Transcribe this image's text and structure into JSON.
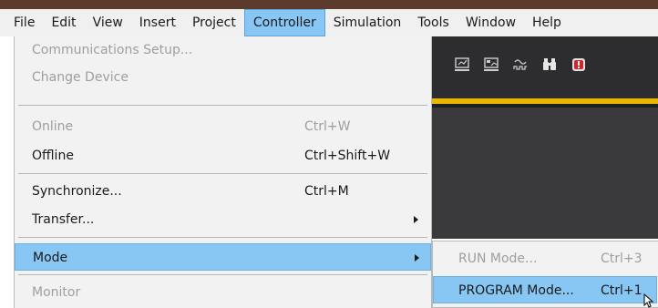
{
  "menubar": {
    "items": [
      {
        "label": "File"
      },
      {
        "label": "Edit"
      },
      {
        "label": "View"
      },
      {
        "label": "Insert"
      },
      {
        "label": "Project"
      },
      {
        "label": "Controller",
        "active": true
      },
      {
        "label": "Simulation"
      },
      {
        "label": "Tools"
      },
      {
        "label": "Window"
      },
      {
        "label": "Help"
      }
    ]
  },
  "toolbar": {
    "icons": [
      "network-scan-icon",
      "network-scan-alt-icon",
      "waveform-icon",
      "binoculars-icon",
      "error-alert-icon"
    ]
  },
  "controller_menu": {
    "communications_setup": "Communications Setup...",
    "change_device": "Change Device",
    "online": {
      "label": "Online",
      "shortcut": "Ctrl+W"
    },
    "offline": {
      "label": "Offline",
      "shortcut": "Ctrl+Shift+W"
    },
    "synchronize": {
      "label": "Synchronize...",
      "shortcut": "Ctrl+M"
    },
    "transfer": {
      "label": "Transfer..."
    },
    "mode": {
      "label": "Mode"
    },
    "monitor": {
      "label": "Monitor"
    }
  },
  "mode_submenu": {
    "run_mode": {
      "label": "RUN Mode...",
      "shortcut": "Ctrl+3"
    },
    "program_mode": {
      "label": "PROGRAM Mode...",
      "shortcut": "Ctrl+1"
    }
  },
  "colors": {
    "highlight": "#88c6f4",
    "menu_background": "#f2f2f2",
    "disabled_text": "#9e9e9e",
    "toolbar_dark": "#2d2d30",
    "accent_yellow": "#e8b800"
  }
}
